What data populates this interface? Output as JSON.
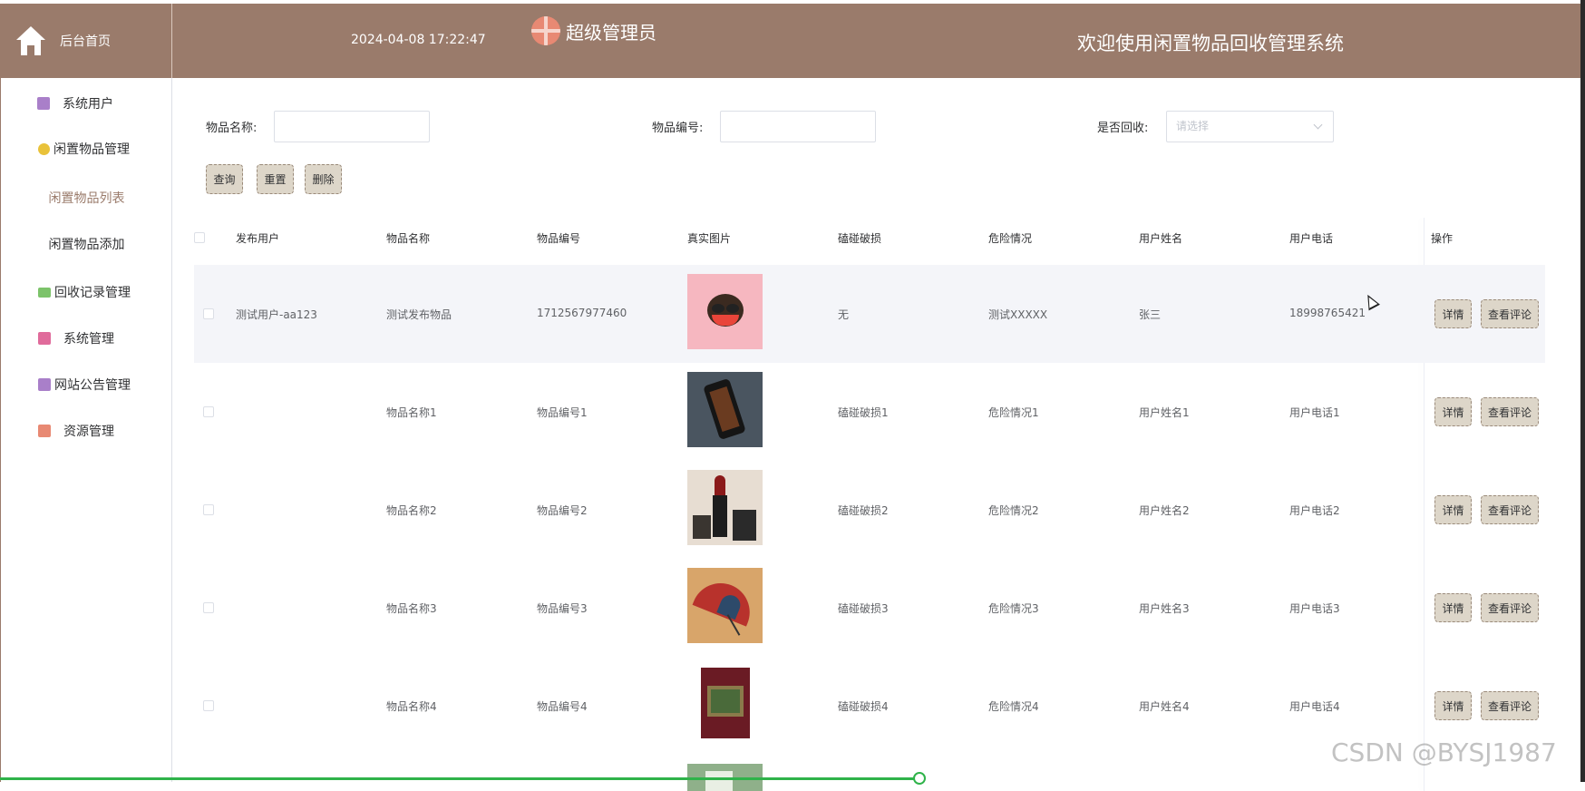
{
  "header": {
    "home_label": "后台首页",
    "datetime": "2024-04-08 17:22:47",
    "admin_name": "超级管理员",
    "site_title": "欢迎使用闲置物品回收管理系统"
  },
  "sidebar": {
    "items": [
      {
        "label": "系统用户",
        "icon": "archive-icon",
        "color": "#a97fc9"
      },
      {
        "label": "闲置物品管理",
        "icon": "hexagon-icon",
        "color": "#e9c23a"
      },
      {
        "label": "回收记录管理",
        "icon": "chat-icon",
        "color": "#7cc36a"
      },
      {
        "label": "系统管理",
        "icon": "badge-icon",
        "color": "#e06b9b"
      },
      {
        "label": "网站公告管理",
        "icon": "archive-icon",
        "color": "#a97fc9"
      },
      {
        "label": "资源管理",
        "icon": "grid-icon",
        "color": "#e88973"
      }
    ],
    "subitems": [
      {
        "label": "闲置物品列表",
        "active": true
      },
      {
        "label": "闲置物品添加",
        "active": false
      }
    ]
  },
  "search": {
    "name_label": "物品名称:",
    "name_value": "",
    "code_label": "物品编号:",
    "code_value": "",
    "recycle_label": "是否回收:",
    "recycle_placeholder": "请选择"
  },
  "buttons": {
    "query": "查询",
    "reset": "重置",
    "delete": "删除"
  },
  "table": {
    "headers": [
      "发布用户",
      "物品名称",
      "物品编号",
      "真实图片",
      "磕碰破损",
      "危险情况",
      "用户姓名",
      "用户电话",
      "操作"
    ],
    "rows": [
      {
        "user": "测试用户-aa123",
        "name": "测试发布物品",
        "code": "1712567977460",
        "image": "monkey-face-image",
        "damage": "无",
        "danger": "测试XXXXX",
        "person": "张三",
        "phone": "18998765421"
      },
      {
        "user": "",
        "name": "物品名称1",
        "code": "物品编号1",
        "image": "phone-image",
        "damage": "磕碰破损1",
        "danger": "危险情况1",
        "person": "用户姓名1",
        "phone": "用户电话1"
      },
      {
        "user": "",
        "name": "物品名称2",
        "code": "物品编号2",
        "image": "lipstick-image",
        "damage": "磕碰破损2",
        "danger": "危险情况2",
        "person": "用户姓名2",
        "phone": "用户电话2"
      },
      {
        "user": "",
        "name": "物品名称3",
        "code": "物品编号3",
        "image": "umbrella-image",
        "damage": "磕碰破损3",
        "danger": "危险情况3",
        "person": "用户姓名3",
        "phone": "用户电话3"
      },
      {
        "user": "",
        "name": "物品名称4",
        "code": "物品编号4",
        "image": "book-image",
        "damage": "磕碰破损4",
        "danger": "危险情况4",
        "person": "用户姓名4",
        "phone": "用户电话4"
      }
    ],
    "detail_label": "详情",
    "comment_label": "查看评论"
  },
  "watermark": "CSDN @BYSJ1987",
  "colors": {
    "header_bg": "#9a7b6b",
    "button_bg": "#ddd6c9",
    "active_text": "#9a7b6b",
    "highlight_row": "#f4f5f9"
  }
}
